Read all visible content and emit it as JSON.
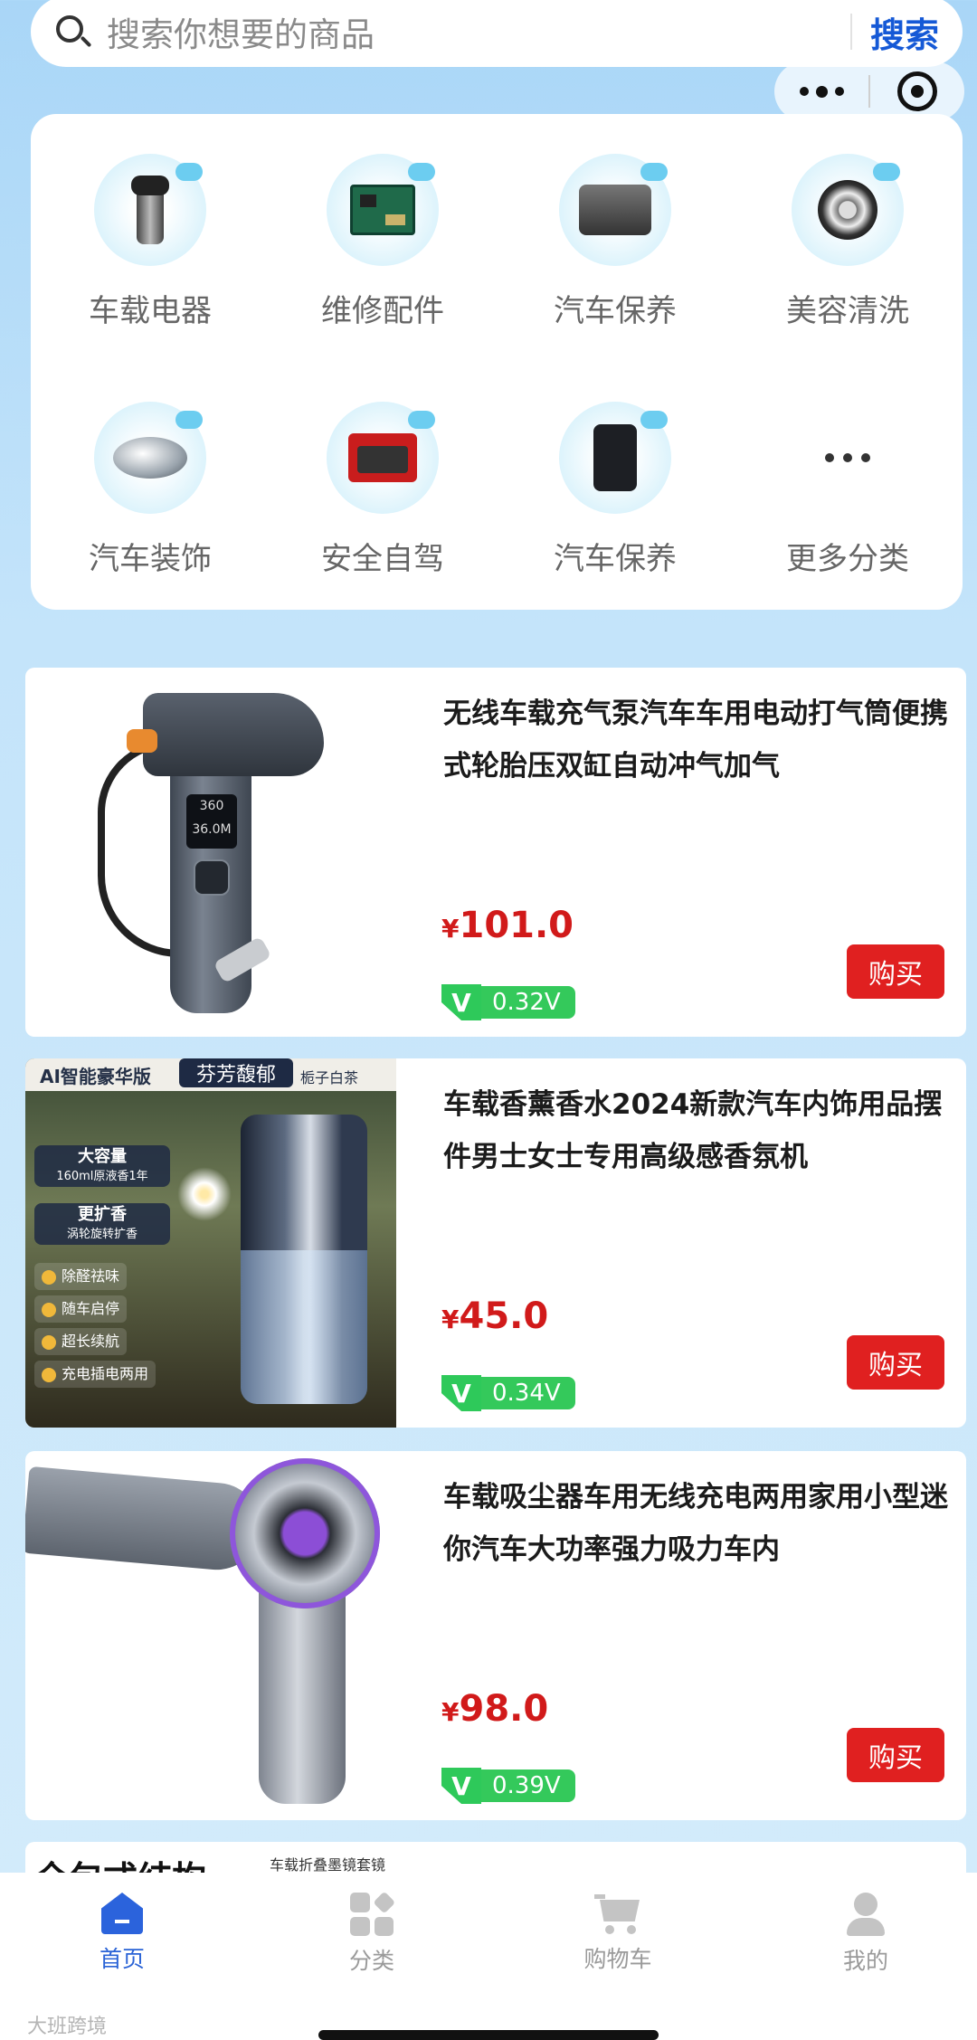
{
  "search": {
    "placeholder": "搜索你想要的商品",
    "button_label": "搜索"
  },
  "categories": [
    {
      "label": "车载电器",
      "icon": "car-charger-icon"
    },
    {
      "label": "维修配件",
      "icon": "circuit-board-icon"
    },
    {
      "label": "汽车保养",
      "icon": "engine-icon"
    },
    {
      "label": "美容清洗",
      "icon": "wheel-icon"
    },
    {
      "label": "汽车装饰",
      "icon": "car-ornament-icon"
    },
    {
      "label": "安全自驾",
      "icon": "emergency-kit-icon"
    },
    {
      "label": "汽车保养",
      "icon": "air-pump-icon"
    },
    {
      "label": "更多分类",
      "icon": "more-dots-icon"
    }
  ],
  "products": [
    {
      "title": "无线车载充气泵汽车车用电动打气筒便携式轮胎压双缸自动冲气加气",
      "currency": "¥",
      "price": "101.0",
      "v_letter": "V",
      "v_value": "0.32V",
      "buy_label": "购买",
      "screen_text_1": "360",
      "screen_text_2": "36.0M"
    },
    {
      "title": "车载香薰香水2024新款汽车内饰用品摆件男士女士专用高级感香氛机",
      "currency": "¥",
      "price": "45.0",
      "v_letter": "V",
      "v_value": "0.34V",
      "buy_label": "购买",
      "image_texts": {
        "tag1": "AI智能豪华版",
        "tag2": "芬芳馥郁",
        "tag3": "栀子白茶",
        "label1_title": "大容量",
        "label1_sub": "160ml原液香1年",
        "label2_title": "更扩香",
        "label2_sub": "涡轮旋转扩香",
        "features": [
          "除醛祛味",
          "随车启停",
          "超长续航",
          "充电插电两用"
        ]
      }
    },
    {
      "title": "车载吸尘器车用无线充电两用家用小型迷你汽车大功率强力吸力车内",
      "currency": "¥",
      "price": "98.0",
      "v_letter": "V",
      "v_value": "0.39V",
      "buy_label": "购买"
    },
    {
      "title": "全包式结构",
      "sub": "车载折叠墨镜套镜"
    }
  ],
  "tabbar": [
    {
      "label": "首页",
      "icon": "home-icon",
      "active": true,
      "color": "#2a63d6"
    },
    {
      "label": "分类",
      "icon": "category-icon",
      "active": false
    },
    {
      "label": "购物车",
      "icon": "cart-icon",
      "active": false
    },
    {
      "label": "我的",
      "icon": "user-icon",
      "active": false
    }
  ],
  "watermark": "大班跨境",
  "colors": {
    "accent": "#1559d6",
    "price": "#d11a1a",
    "buy": "#e02020",
    "badge": "#2ec95a"
  }
}
